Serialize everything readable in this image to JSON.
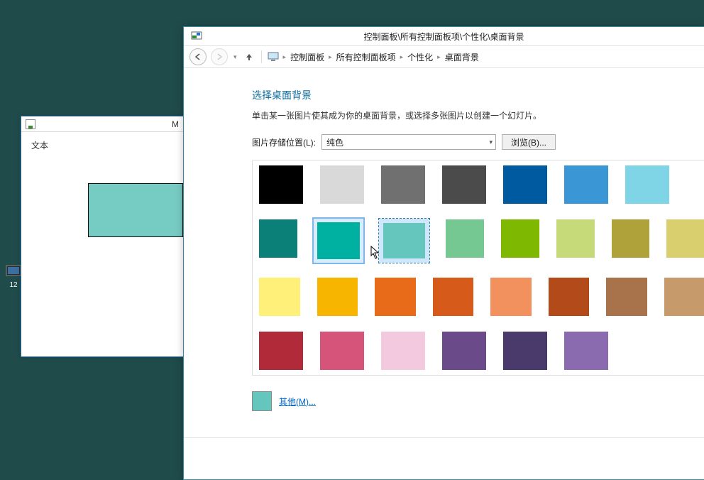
{
  "desktop": {
    "icons": [
      {
        "label": "12"
      }
    ]
  },
  "bg_window": {
    "title_right": "M",
    "text_label": "文本"
  },
  "main_window": {
    "title": "控制面板\\所有控制面板项\\个性化\\桌面背景",
    "breadcrumb": [
      "控制面板",
      "所有控制面板项",
      "个性化",
      "桌面背景"
    ],
    "heading": "选择桌面背景",
    "subheading": "单击某一张图片使其成为你的桌面背景，或选择多张图片以创建一个幻灯片。",
    "location_label": "图片存储位置(L):",
    "location_value": "纯色",
    "browse_label": "浏览(B)...",
    "other_label": "其他(M)...",
    "current_color": "#64c6bc",
    "swatches": [
      [
        "#000000",
        "#d9d9d9",
        "#707070",
        "#4b4b4b",
        "#005aa0",
        "#3b96d6",
        "#7fd4e6"
      ],
      [
        "#0b8078",
        "#00b0a0",
        "#64c6bc",
        "#76c893",
        "#7fb800",
        "#c6da7a",
        "#b0a23a",
        "#d9cf6f"
      ],
      [
        "#fff07a",
        "#f7b500",
        "#e86b1a",
        "#d65a1a",
        "#f2915e",
        "#b24a1a",
        "#a8734a",
        "#c79a6b"
      ],
      [
        "#b02a3a",
        "#d6547a",
        "#f2c9de",
        "#6b4a8a",
        "#4a3a6b",
        "#8a6bb0"
      ]
    ],
    "hover_index": [
      1,
      1
    ],
    "selected_index": [
      1,
      2
    ]
  }
}
